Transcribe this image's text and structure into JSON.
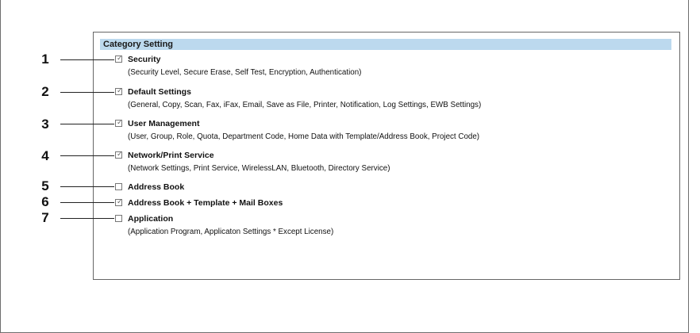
{
  "category_setting": {
    "title": "Category Setting",
    "items": [
      {
        "number": "1",
        "label": "Security",
        "checked": true,
        "description": "(Security Level, Secure Erase, Self Test, Encryption, Authentication)"
      },
      {
        "number": "2",
        "label": "Default Settings",
        "checked": true,
        "description": "(General, Copy, Scan, Fax, iFax, Email, Save as File, Printer, Notification, Log Settings, EWB Settings)"
      },
      {
        "number": "3",
        "label": "User Management",
        "checked": true,
        "description": "(User, Group, Role, Quota, Department Code, Home Data with Template/Address Book, Project Code)"
      },
      {
        "number": "4",
        "label": "Network/Print Service",
        "checked": true,
        "description": "(Network Settings, Print Service, WirelessLAN, Bluetooth, Directory Service)"
      },
      {
        "number": "5",
        "label": "Address Book",
        "checked": false,
        "description": ""
      },
      {
        "number": "6",
        "label": "Address Book + Template + Mail Boxes",
        "checked": true,
        "description": ""
      },
      {
        "number": "7",
        "label": "Application",
        "checked": false,
        "description": "(Application Program, Applicaton Settings * Except License)"
      }
    ]
  },
  "checkmark_glyph": "✓"
}
